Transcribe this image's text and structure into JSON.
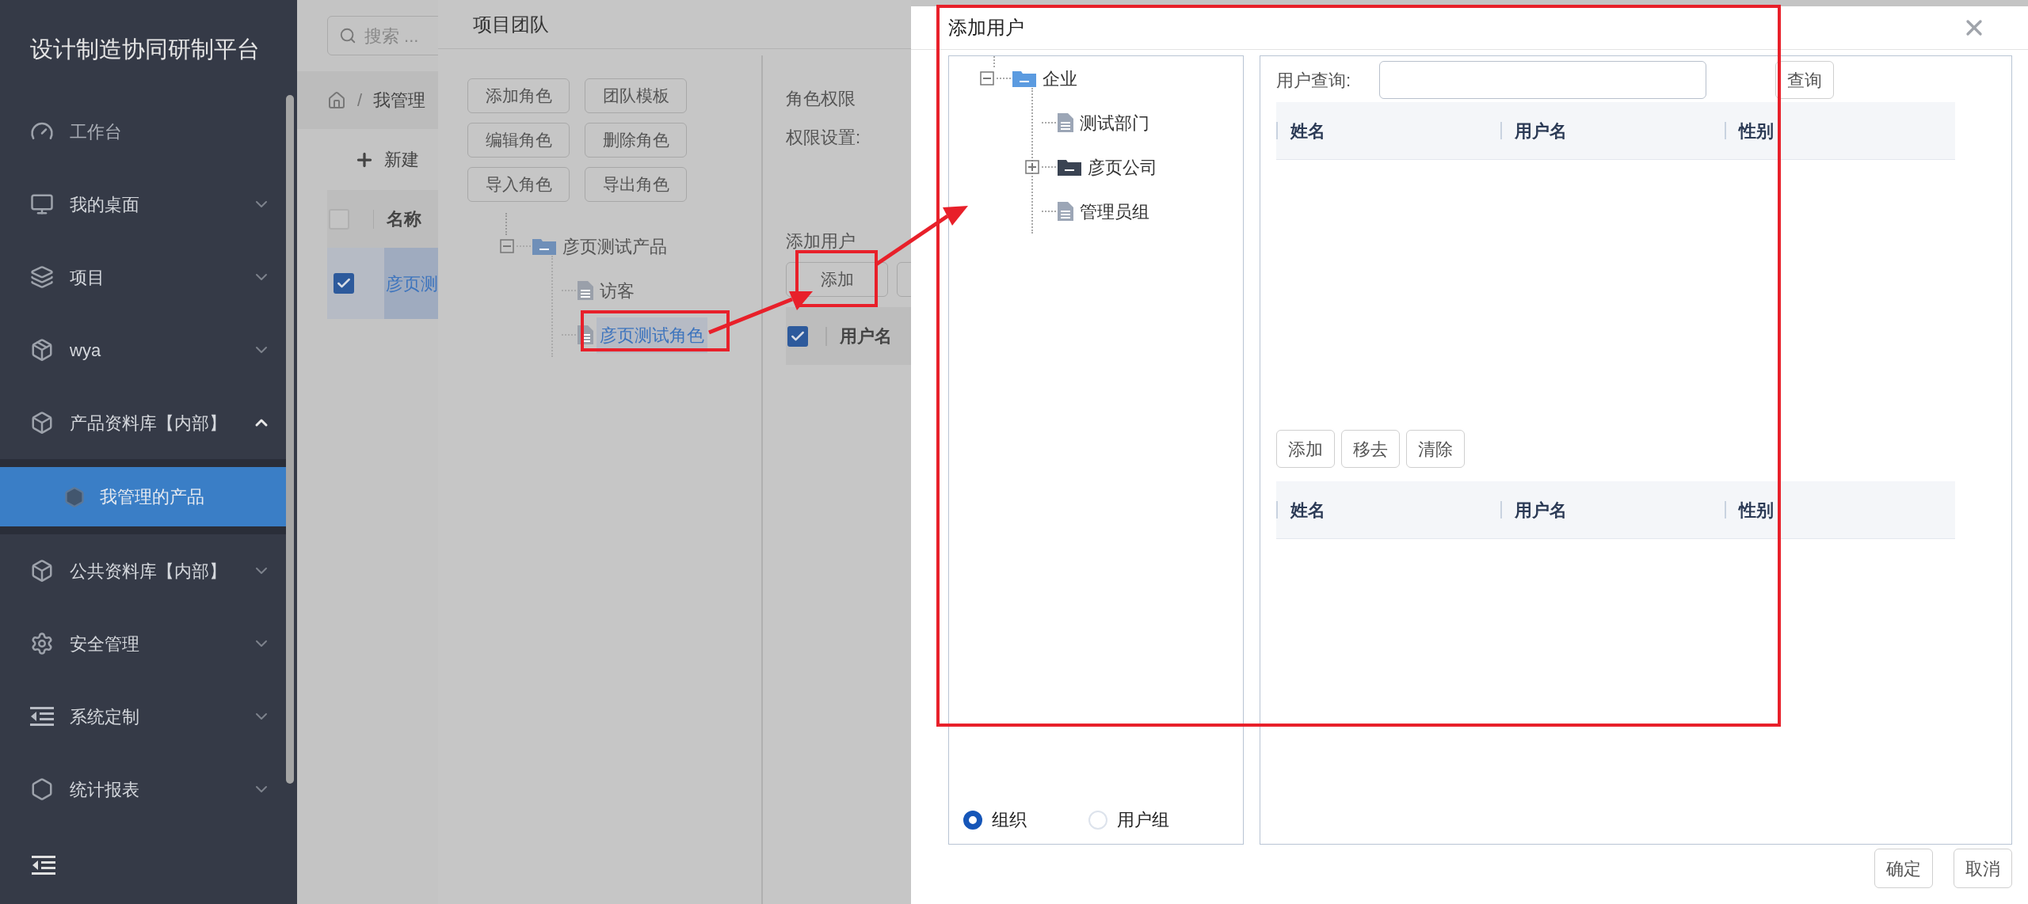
{
  "sidebar": {
    "title": "设计制造协同研制平台",
    "items": [
      {
        "label": "工作台",
        "selected": false
      },
      {
        "label": "我的桌面",
        "expanded": false,
        "selected": false
      },
      {
        "label": "项目",
        "expanded": false,
        "selected": false
      },
      {
        "label": "wya",
        "expanded": false,
        "selected": false
      },
      {
        "label": "产品资料库【内部】",
        "expanded": true,
        "selected": false,
        "children": [
          {
            "label": "我管理的产品",
            "selected": true
          }
        ]
      },
      {
        "label": "公共资料库【内部】",
        "expanded": false,
        "selected": false
      },
      {
        "label": "安全管理",
        "expanded": false,
        "selected": false
      },
      {
        "label": "系统定制",
        "expanded": false,
        "selected": false
      },
      {
        "label": "统计报表",
        "expanded": false,
        "selected": false
      }
    ]
  },
  "page": {
    "search": {
      "placeholder": "搜索 ..."
    },
    "breadcrumb_separator": "/",
    "breadcrumb": [
      "我管理"
    ],
    "new_button": "新建",
    "table": {
      "header_checked": false,
      "columns": [
        "名称"
      ],
      "rows": [
        {
          "cells": [
            "彦页测"
          ],
          "checked": true,
          "selected": true
        }
      ]
    }
  },
  "team_dialog": {
    "title": "项目团队",
    "buttons": [
      "添加角色",
      "团队模板",
      "编辑角色",
      "删除角色",
      "导入角色",
      "导出角色"
    ],
    "tree": [
      {
        "label": "彦页测试产品",
        "kind": "folder",
        "expanded": true,
        "selected": false,
        "children": [
          {
            "label": "访客",
            "kind": "leaf",
            "selected": false
          },
          {
            "label": "彦页测试角色",
            "kind": "leaf",
            "selected": true
          }
        ]
      }
    ],
    "role_permission": "角色权限",
    "permission_setting": "权限设置:",
    "add_user_section": "添加用户",
    "add_button": "添加",
    "table": {
      "header_checked": true,
      "columns": [
        "用户名"
      ]
    }
  },
  "user_dialog": {
    "title": "添加用户",
    "tree": [
      {
        "label": "企业",
        "kind": "folder",
        "expanded": true,
        "selected": false,
        "children": [
          {
            "label": "测试部门",
            "kind": "leaf",
            "selected": false
          },
          {
            "label": "彦页公司",
            "kind": "folder",
            "expanded": false,
            "selected": false
          },
          {
            "label": "管理员组",
            "kind": "leaf",
            "selected": false
          }
        ]
      }
    ],
    "radios": [
      {
        "label": "组织",
        "selected": true
      },
      {
        "label": "用户组",
        "selected": false
      }
    ],
    "query_label": "用户查询:",
    "query_button": "查询",
    "results_table": {
      "columns": [
        "姓名",
        "用户名",
        "性别"
      ]
    },
    "actions": [
      "添加",
      "移去",
      "清除"
    ],
    "selected_table": {
      "columns": [
        "姓名",
        "用户名",
        "性别"
      ]
    },
    "footer_buttons": [
      "确定",
      "取消"
    ]
  }
}
